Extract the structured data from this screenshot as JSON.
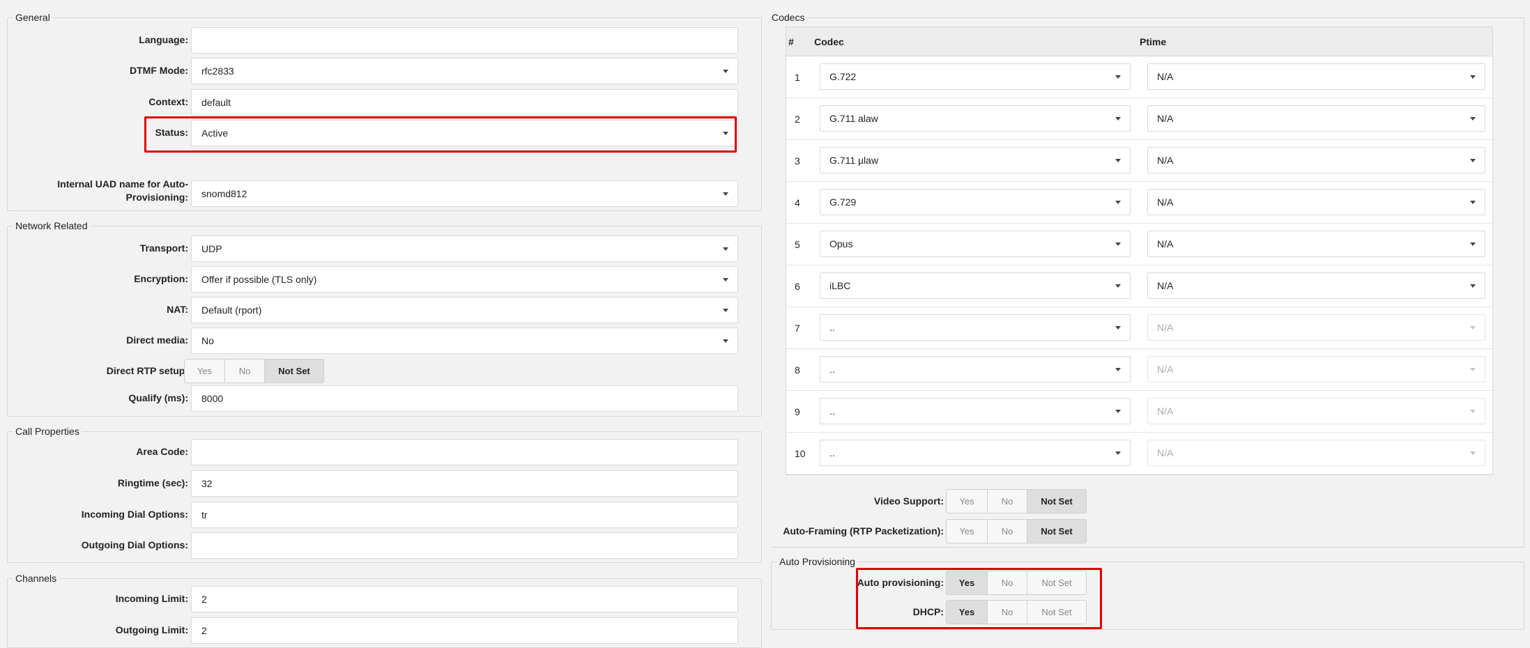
{
  "general": {
    "legend": "General",
    "language_label": "Language:",
    "language_value": "",
    "dtmf_label": "DTMF Mode:",
    "dtmf_value": "rfc2833",
    "context_label": "Context:",
    "context_value": "default",
    "status_label": "Status:",
    "status_value": "Active",
    "uad_label_line1": "Internal UAD name for Auto-",
    "uad_label_line2": "Provisioning:",
    "uad_value": "snomd812"
  },
  "network": {
    "legend": "Network Related",
    "transport_label": "Transport:",
    "transport_value": "UDP",
    "encryption_label": "Encryption:",
    "encryption_value": "Offer if possible (TLS only)",
    "nat_label": "NAT:",
    "nat_value": "Default (rport)",
    "direct_media_label": "Direct media:",
    "direct_media_value": "No",
    "direct_rtp_label": "Direct RTP setup:",
    "direct_rtp_options": [
      "Yes",
      "No",
      "Not Set"
    ],
    "direct_rtp_selected": "Not Set",
    "qualify_label": "Qualify (ms):",
    "qualify_value": "8000"
  },
  "call": {
    "legend": "Call Properties",
    "area_code_label": "Area Code:",
    "area_code_value": "",
    "ringtime_label": "Ringtime (sec):",
    "ringtime_value": "32",
    "incoming_dial_label": "Incoming Dial Options:",
    "incoming_dial_value": "tr",
    "outgoing_dial_label": "Outgoing Dial Options:",
    "outgoing_dial_value": ""
  },
  "channels": {
    "legend": "Channels",
    "incoming_limit_label": "Incoming Limit:",
    "incoming_limit_value": "2",
    "outgoing_limit_label": "Outgoing Limit:",
    "outgoing_limit_value": "2"
  },
  "codecs": {
    "legend": "Codecs",
    "col_num": "#",
    "col_codec": "Codec",
    "col_ptime": "Ptime",
    "rows": [
      {
        "num": "1",
        "codec": "G.722",
        "ptime": "N/A",
        "enabled": true
      },
      {
        "num": "2",
        "codec": "G.711 alaw",
        "ptime": "N/A",
        "enabled": true
      },
      {
        "num": "3",
        "codec": "G.711 µlaw",
        "ptime": "N/A",
        "enabled": true
      },
      {
        "num": "4",
        "codec": "G.729",
        "ptime": "N/A",
        "enabled": true
      },
      {
        "num": "5",
        "codec": "Opus",
        "ptime": "N/A",
        "enabled": true
      },
      {
        "num": "6",
        "codec": "iLBC",
        "ptime": "N/A",
        "enabled": true
      },
      {
        "num": "7",
        "codec": "..",
        "ptime": "N/A",
        "enabled": false
      },
      {
        "num": "8",
        "codec": "..",
        "ptime": "N/A",
        "enabled": false
      },
      {
        "num": "9",
        "codec": "..",
        "ptime": "N/A",
        "enabled": false
      },
      {
        "num": "10",
        "codec": "..",
        "ptime": "N/A",
        "enabled": false
      }
    ],
    "video_label": "Video Support:",
    "video_options": [
      "Yes",
      "No",
      "Not Set"
    ],
    "video_selected": "Not Set",
    "autoframing_label": "Auto-Framing (RTP Packetization):",
    "autoframing_options": [
      "Yes",
      "No",
      "Not Set"
    ],
    "autoframing_selected": "Not Set"
  },
  "autoprov": {
    "legend": "Auto Provisioning",
    "auto_label": "Auto provisioning:",
    "auto_options": [
      "Yes",
      "No",
      "Not Set"
    ],
    "auto_selected": "Yes",
    "dhcp_label": "DHCP:",
    "dhcp_options": [
      "Yes",
      "No",
      "Not Set"
    ],
    "dhcp_selected": "Yes"
  },
  "colors": {
    "highlight": "#e00000",
    "background": "#f2f2f2",
    "selected_toggle": "#dedede"
  }
}
